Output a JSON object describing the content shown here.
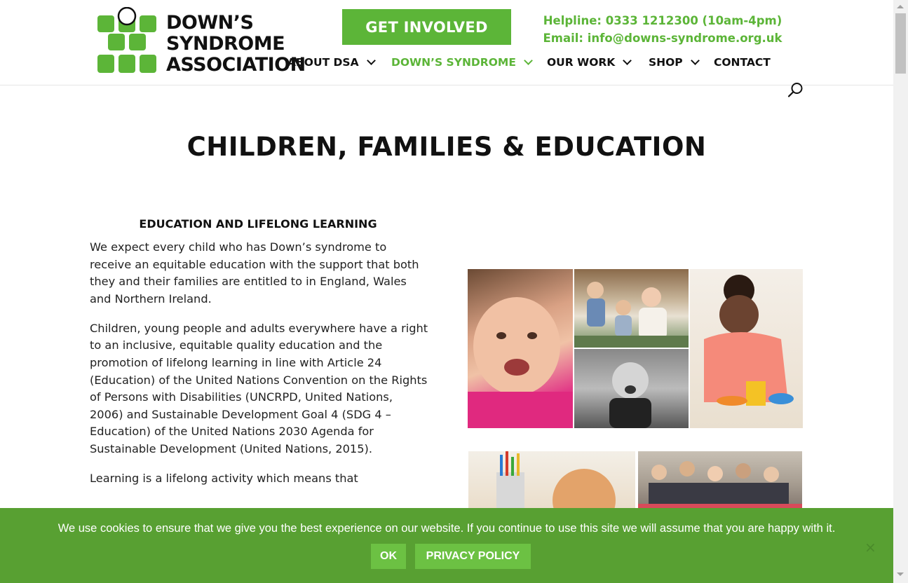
{
  "logo": {
    "line1": "DOWN’S",
    "line2": "SYNDROME",
    "line3": "ASSOCIATION"
  },
  "header": {
    "cta_label": "GET INVOLVED",
    "helpline": "Helpline: 0333 1212300 (10am-4pm)",
    "email": "Email: info@downs-syndrome.org.uk"
  },
  "nav": {
    "items": [
      {
        "label": "ABOUT DSA",
        "has_dropdown": true,
        "active": false
      },
      {
        "label": "DOWN’S SYNDROME",
        "has_dropdown": true,
        "active": true
      },
      {
        "label": "OUR WORK",
        "has_dropdown": true,
        "active": false
      },
      {
        "label": "SHOP",
        "has_dropdown": true,
        "active": false
      },
      {
        "label": "CONTACT",
        "has_dropdown": false,
        "active": false
      }
    ]
  },
  "page": {
    "title": "CHILDREN, FAMILIES & EDUCATION",
    "section_heading": "EDUCATION AND LIFELONG LEARNING",
    "paragraphs": [
      "We expect every child who has Down’s syndrome to receive an equitable education with the support that both they and their families are entitled to in England, Wales and Northern Ireland.",
      "Children, young people and adults everywhere have a right to an inclusive, equitable quality education and the promotion of lifelong learning in line with Article 24 (Education) of the United Nations Convention on the Rights of Persons with Disabilities (UNCRPD, United Nations, 2006) and Sustainable Development Goal 4 (SDG 4 – Education) of the United Nations 2030 Agenda for Sustainable Development (United Nations, 2015).",
      "Learning is a lifelong activity which means that"
    ]
  },
  "cookie": {
    "message": "We use cookies to ensure that we give you the best experience on our website. If you continue to use this site we will assume that you are happy with it.",
    "ok_label": "OK",
    "privacy_label": "PRIVACY POLICY",
    "close_glyph": "×"
  },
  "colors": {
    "brand_green": "#5cb538",
    "cookie_bg": "#58a032",
    "button_green": "#6cc143"
  },
  "icons": {
    "search": "search-icon",
    "dropdown": "chevron-down-icon",
    "close": "close-icon"
  }
}
